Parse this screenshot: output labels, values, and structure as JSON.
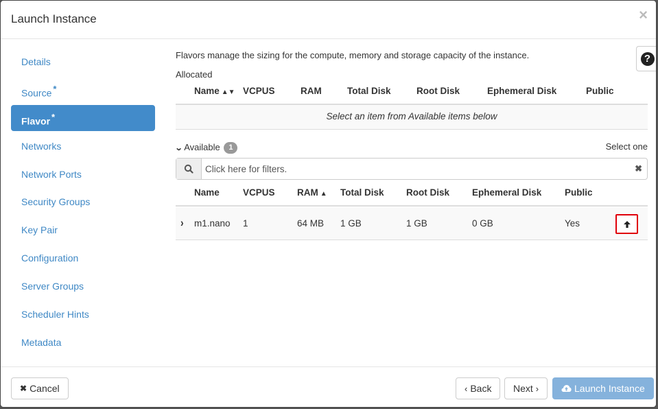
{
  "modal": {
    "title": "Launch Instance",
    "close_icon": "×"
  },
  "sidebar": {
    "items": [
      {
        "label": "Details",
        "required": false,
        "active": false
      },
      {
        "label": "Source",
        "required": true,
        "active": false
      },
      {
        "label": "Flavor",
        "required": true,
        "active": true
      },
      {
        "label": "Networks",
        "required": false,
        "active": false
      },
      {
        "label": "Network Ports",
        "required": false,
        "active": false
      },
      {
        "label": "Security Groups",
        "required": false,
        "active": false
      },
      {
        "label": "Key Pair",
        "required": false,
        "active": false
      },
      {
        "label": "Configuration",
        "required": false,
        "active": false
      },
      {
        "label": "Server Groups",
        "required": false,
        "active": false
      },
      {
        "label": "Scheduler Hints",
        "required": false,
        "active": false
      },
      {
        "label": "Metadata",
        "required": false,
        "active": false
      }
    ],
    "required_marker": "*"
  },
  "help": {
    "icon": "?"
  },
  "content": {
    "description": "Flavors manage the sizing for the compute, memory and storage capacity of the instance.",
    "allocated": {
      "label": "Allocated",
      "columns": [
        "Name",
        "VCPUS",
        "RAM",
        "Total Disk",
        "Root Disk",
        "Ephemeral Disk",
        "Public"
      ],
      "empty_message": "Select an item from Available items below"
    },
    "available": {
      "label": "Available",
      "count": "1",
      "select_hint": "Select one",
      "filter_placeholder": "Click here for filters.",
      "filter_value": "",
      "columns": [
        "Name",
        "VCPUS",
        "RAM",
        "Total Disk",
        "Root Disk",
        "Ephemeral Disk",
        "Public"
      ],
      "rows": [
        {
          "name": "m1.nano",
          "vcpus": "1",
          "ram": "64 MB",
          "total_disk": "1 GB",
          "root_disk": "1 GB",
          "ephemeral_disk": "0 GB",
          "public": "Yes"
        }
      ]
    }
  },
  "footer": {
    "cancel": "Cancel",
    "back": "Back",
    "next": "Next",
    "launch": "Launch Instance"
  },
  "colors": {
    "accent": "#428bca",
    "link": "#3f88c5",
    "launch_disabled": "#85b2dc",
    "highlight_border": "#e0000a"
  }
}
